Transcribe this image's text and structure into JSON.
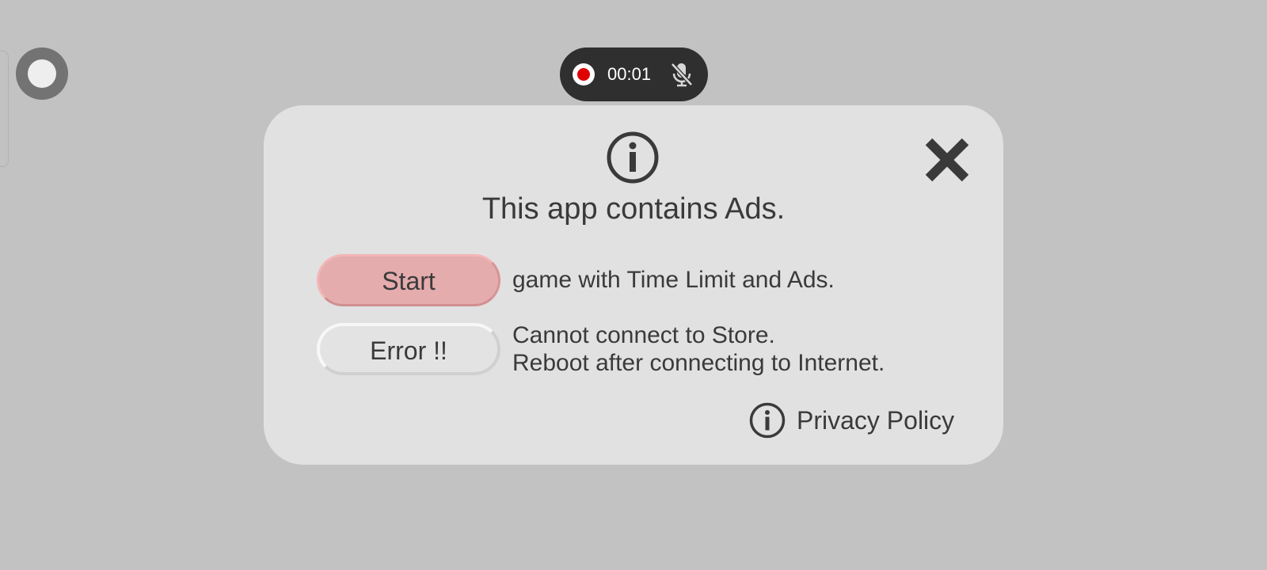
{
  "recorder": {
    "time": "00:01",
    "status_icon": "record-icon",
    "mic_icon": "mic-muted-icon",
    "record_color": "#e00000"
  },
  "floating": {
    "icon": "floating-assist-button"
  },
  "dialog": {
    "icon": "info-icon",
    "close_icon": "close-icon",
    "title": "This app contains Ads.",
    "start_button": "Start",
    "start_desc": "game with Time Limit and Ads.",
    "error_button": "Error !!",
    "error_desc_line1": "Cannot connect to Store.",
    "error_desc_line2": "Reboot after connecting to Internet.",
    "privacy_label": "Privacy Policy",
    "start_color": "#e5acad",
    "background": "#e1e1e1"
  }
}
